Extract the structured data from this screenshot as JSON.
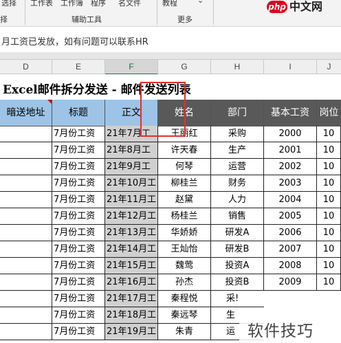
{
  "ribbon": {
    "top_fragments": [
      "选择",
      "工作表",
      "工作簿",
      "程序",
      "名文件",
      "教程"
    ],
    "bottom_fragments": [
      "择",
      "辅助工具",
      "更多"
    ]
  },
  "logo": {
    "badge": "php",
    "text": "中文网"
  },
  "notice": "月工资已发放，如有问题可以联系HR",
  "columns": [
    "D",
    "E",
    "F",
    "G",
    "H",
    "I",
    "J"
  ],
  "sheet_title": "Excel邮件拆分发送 - 邮件发送列表",
  "headers": [
    "暗送地址",
    "标题",
    "正文",
    "姓名",
    "部门",
    "基本工资",
    "岗位"
  ],
  "rows": [
    {
      "title": "7月份工资",
      "body": "21年7月工",
      "name": "王丽红",
      "dept": "采购",
      "salary": "2000",
      "post": "10"
    },
    {
      "title": "7月份工资",
      "body": "21年8月工",
      "name": "许天春",
      "dept": "生产",
      "salary": "2001",
      "post": "10"
    },
    {
      "title": "7月份工资",
      "body": "21年9月工",
      "name": "何琴",
      "dept": "运营",
      "salary": "2002",
      "post": "10"
    },
    {
      "title": "7月份工资",
      "body": "21年10月工",
      "name": "柳桂兰",
      "dept": "财务",
      "salary": "2003",
      "post": "10"
    },
    {
      "title": "7月份工资",
      "body": "21年11月工",
      "name": "赵黛",
      "dept": "人力",
      "salary": "2004",
      "post": "10"
    },
    {
      "title": "7月份工资",
      "body": "21年12月工",
      "name": "杨桂兰",
      "dept": "销售",
      "salary": "2005",
      "post": "10"
    },
    {
      "title": "7月份工资",
      "body": "21年13月工",
      "name": "华娇娇",
      "dept": "研发A",
      "salary": "2006",
      "post": "10"
    },
    {
      "title": "7月份工资",
      "body": "21年14月工",
      "name": "王灿怡",
      "dept": "研发B",
      "salary": "2007",
      "post": "10"
    },
    {
      "title": "7月份工资",
      "body": "21年15月工",
      "name": "魏莺",
      "dept": "投资A",
      "salary": "2008",
      "post": "10"
    },
    {
      "title": "7月份工资",
      "body": "21年16月工",
      "name": "孙杰",
      "dept": "投资B",
      "salary": "2009",
      "post": "10"
    },
    {
      "title": "7月份工资",
      "body": "21年17月工",
      "name": "秦程悦",
      "dept": "采!",
      "salary": "",
      "post": ""
    },
    {
      "title": "7月份工资",
      "body": "21年18月工",
      "name": "秦远琴",
      "dept": "生",
      "salary": "",
      "post": ""
    },
    {
      "title": "7月份工资",
      "body": "21年19月工",
      "name": "朱青",
      "dept": "运",
      "salary": "",
      "post": ""
    }
  ],
  "watermark": "软件技巧",
  "colors": {
    "header_blue": "#9dc3e6",
    "header_dark": "#595959",
    "selected_col": "#d0d0d0",
    "highlight_box": "#e03030"
  }
}
